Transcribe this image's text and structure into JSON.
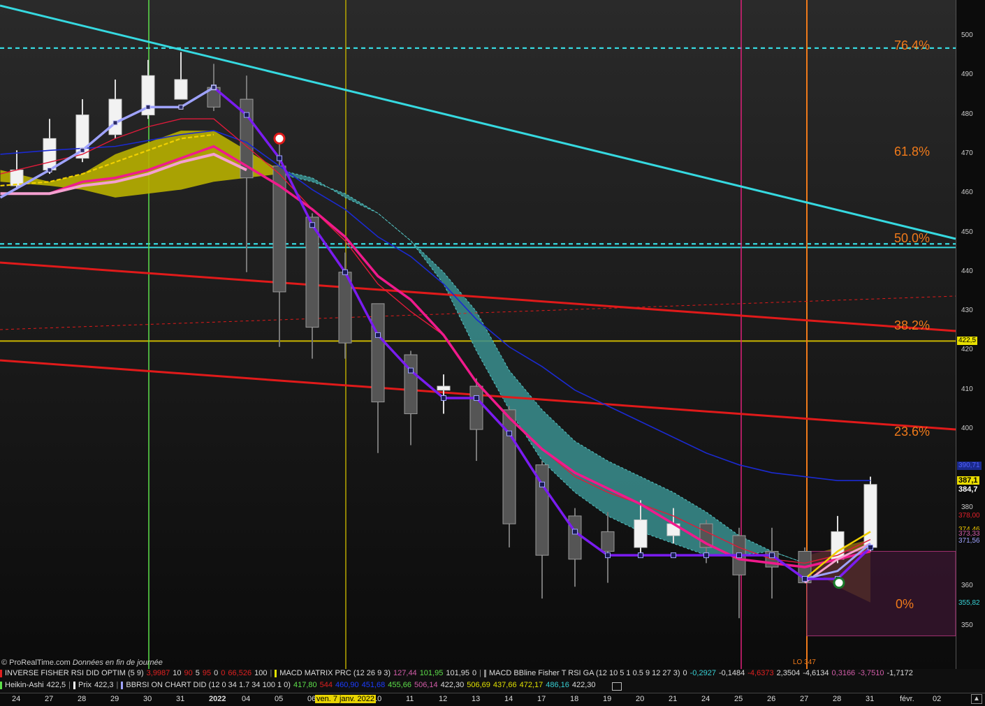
{
  "chart_data": {
    "type": "candlestick",
    "price_axis": {
      "ylim": [
        343,
        510
      ],
      "ticks": [
        500,
        490,
        480,
        470,
        460,
        450,
        440,
        430,
        420,
        410,
        400,
        380,
        360,
        350
      ],
      "tick_labels": [
        "500",
        "490",
        "480",
        "470",
        "460",
        "450",
        "440",
        "430",
        "420",
        "410",
        "400",
        "380",
        "360",
        "350"
      ]
    },
    "dates": [
      "24",
      "27",
      "28",
      "29",
      "30",
      "31",
      "2022",
      "04",
      "05",
      "06",
      "07",
      "10",
      "11",
      "12",
      "13",
      "14",
      "17",
      "18",
      "19",
      "20",
      "21",
      "24",
      "25",
      "26",
      "27",
      "28",
      "31",
      "févr.",
      "02"
    ],
    "candles": [
      {
        "o": 462,
        "h": 471,
        "l": 461,
        "c": 466,
        "bull": true
      },
      {
        "o": 466,
        "h": 479,
        "l": 465,
        "c": 474,
        "bull": true
      },
      {
        "o": 469,
        "h": 484,
        "l": 468,
        "c": 480,
        "bull": true
      },
      {
        "o": 475,
        "h": 489,
        "l": 474,
        "c": 484,
        "bull": true
      },
      {
        "o": 480,
        "h": 494,
        "l": 479,
        "c": 490,
        "bull": true
      },
      {
        "o": 484,
        "h": 496,
        "l": 484,
        "c": 489,
        "bull": true
      },
      {
        "o": 487,
        "h": 493,
        "l": 481,
        "c": 482,
        "bull": false
      },
      {
        "o": 484,
        "h": 490,
        "l": 440,
        "c": 464,
        "bull": false
      },
      {
        "o": 467,
        "h": 474,
        "l": 421,
        "c": 435,
        "bull": false
      },
      {
        "o": 454,
        "h": 455,
        "l": 418,
        "c": 426,
        "bull": false
      },
      {
        "o": 440,
        "h": 445,
        "l": 418,
        "c": 422,
        "bull": false
      },
      {
        "o": 432,
        "h": 432,
        "l": 394,
        "c": 407,
        "bull": false
      },
      {
        "o": 419,
        "h": 420,
        "l": 396,
        "c": 404,
        "bull": false
      },
      {
        "o": 410,
        "h": 414,
        "l": 404,
        "c": 411,
        "bull": true
      },
      {
        "o": 411,
        "h": 413,
        "l": 392,
        "c": 400,
        "bull": false
      },
      {
        "o": 405,
        "h": 406,
        "l": 370,
        "c": 376,
        "bull": false
      },
      {
        "o": 391,
        "h": 392,
        "l": 357,
        "c": 368,
        "bull": false
      },
      {
        "o": 378,
        "h": 380,
        "l": 360,
        "c": 367,
        "bull": false
      },
      {
        "o": 374,
        "h": 379,
        "l": 361,
        "c": 369,
        "bull": false
      },
      {
        "o": 370,
        "h": 382,
        "l": 368,
        "c": 377,
        "bull": true
      },
      {
        "o": 373,
        "h": 380,
        "l": 371,
        "c": 376,
        "bull": true
      },
      {
        "o": 376,
        "h": 377,
        "l": 366,
        "c": 370,
        "bull": false
      },
      {
        "o": 373,
        "h": 375,
        "l": 352,
        "c": 363,
        "bull": false
      },
      {
        "o": 369,
        "h": 375,
        "l": 357,
        "c": 365,
        "bull": false
      },
      {
        "o": 369,
        "h": 370,
        "l": 361,
        "c": 361,
        "bull": false
      },
      {
        "o": 367,
        "h": 378,
        "l": 366,
        "c": 374,
        "bull": true
      },
      {
        "o": 370,
        "h": 388,
        "l": 369,
        "c": 386,
        "bull": true
      }
    ],
    "fib_levels": [
      {
        "label": "76.4%",
        "price": 497.5
      },
      {
        "label": "61.8%",
        "price": 470.5
      },
      {
        "label": "50.0%",
        "price": 448.5
      },
      {
        "label": "38.2%",
        "price": 426.3
      },
      {
        "label": "23.6%",
        "price": 399.3
      },
      {
        "label": "0%",
        "price": 355.5
      }
    ],
    "horizontal_lines": [
      {
        "price": 497,
        "color": "#36d9e0",
        "style": "dashed"
      },
      {
        "price": 447.2,
        "color": "#36d9e0",
        "style": "dashed"
      },
      {
        "price": 446.3,
        "color": "#36d9e0",
        "style": "solid"
      },
      {
        "price": 422.5,
        "color": "#c8b400",
        "style": "solid"
      }
    ],
    "price_labels": [
      {
        "text": "422,5",
        "price": 422.5,
        "bg": "#e8e000",
        "fg": "#000"
      },
      {
        "text": "390,71",
        "price": 390.7,
        "bg": "#1b2a8c",
        "fg": "#1b2a8c"
      },
      {
        "text": "387,1",
        "price": 387.1,
        "bg": "#eadc00",
        "fg": "#000"
      },
      {
        "text": "384,7",
        "price": 384.7,
        "bg": "#0c0c0c",
        "fg": "#ffffff"
      },
      {
        "text": "378,00",
        "price": 378.0,
        "bg": "#0c0c0c",
        "fg": "#e0202a"
      },
      {
        "text": "374,46",
        "price": 374.5,
        "bg": "#0c0c0c",
        "fg": "#f0c800"
      },
      {
        "text": "373,33",
        "price": 373.3,
        "bg": "#0c0c0c",
        "fg": "#d25ca8"
      },
      {
        "text": "371,56",
        "price": 371.6,
        "bg": "#0c0c0c",
        "fg": "#9fa3ff"
      },
      {
        "text": "355,82",
        "price": 355.8,
        "bg": "#0c0c0c",
        "fg": "#37d0d4"
      }
    ],
    "colors": {
      "bull_candle": "#f2f2f2",
      "bear_candle": "#555555",
      "cyan_trend": "#36d9e0",
      "red_trend": "#e01a1a",
      "purple_line": "#7a1cf0",
      "pink_line": "#f01a8c",
      "lavender_line": "#9fa3ff",
      "yellow_cloud": "#b8b000",
      "teal_cloud": "#3a8f8f",
      "vline_green": "#5de04a",
      "vline_yellow": "#b8a800",
      "vline_magenta": "#e0207a",
      "vline_orange": "#f07a1a"
    }
  },
  "footer": {
    "credit_site": "© ProRealTime.com",
    "credit_note": "Données en fin de journée",
    "lo_label": "LO 347",
    "date_highlight": "ven. 7 janv. 2022",
    "indicators_row1": [
      {
        "parts": [
          {
            "t": "INVERSE FISHER RSI DID OPTIM (5 9)",
            "c": "#ddd"
          },
          {
            "t": "3,9987",
            "c": "#e02020"
          },
          {
            "t": "10",
            "c": "#ddd"
          },
          {
            "t": "90",
            "c": "#e02020"
          },
          {
            "t": "5",
            "c": "#ddd"
          },
          {
            "t": "95",
            "c": "#e02020"
          },
          {
            "t": "0",
            "c": "#ddd"
          },
          {
            "t": "0",
            "c": "#e02020"
          },
          {
            "t": "66,526",
            "c": "#e02020"
          },
          {
            "t": "100",
            "c": "#ddd"
          }
        ],
        "box": "#e02020"
      },
      {
        "parts": [
          {
            "t": "MACD MATRIX PRC (12 26 9 3)",
            "c": "#ddd"
          },
          {
            "t": "127,44",
            "c": "#d25ca8"
          },
          {
            "t": "101,95",
            "c": "#5de04a"
          },
          {
            "t": "101,95",
            "c": "#ddd"
          },
          {
            "t": "0",
            "c": "#ddd"
          }
        ],
        "box": "#e0e000"
      },
      {
        "parts": [
          {
            "t": "MACD  BBline  Fisher T RSI  GA (12 10 5 1 0.5 9 12 27 3)",
            "c": "#ddd"
          },
          {
            "t": "0",
            "c": "#ddd"
          },
          {
            "t": "-0,2927",
            "c": "#37d0d4"
          },
          {
            "t": "-0,1484",
            "c": "#ddd"
          },
          {
            "t": "-4,6373",
            "c": "#e02020"
          },
          {
            "t": "2,3504",
            "c": "#ddd"
          },
          {
            "t": "-4,6134",
            "c": "#ddd"
          },
          {
            "t": "0,3166",
            "c": "#d25ca8"
          },
          {
            "t": "-3,7510",
            "c": "#d25ca8"
          },
          {
            "t": "-1,7172",
            "c": "#ddd"
          }
        ],
        "box": "#888"
      }
    ],
    "indicators_row2": [
      {
        "parts": [
          {
            "t": "Heikin-Ashi",
            "c": "#ddd"
          },
          {
            "t": "422,5",
            "c": "#ddd"
          }
        ],
        "box": "#5de04a"
      },
      {
        "parts": [
          {
            "t": "Prix",
            "c": "#ddd"
          },
          {
            "t": "422,3",
            "c": "#ddd"
          }
        ],
        "box": "#ffffff"
      },
      {
        "parts": [
          {
            "t": "BBRSI ON CHART DID (12 0 34 1.7 34 100 1 0)",
            "c": "#ddd"
          },
          {
            "t": "417,80",
            "c": "#5de04a"
          },
          {
            "t": "544",
            "c": "#e02020"
          },
          {
            "t": "460,90",
            "c": "#1b3cff"
          },
          {
            "t": "451,68",
            "c": "#1b3cff"
          },
          {
            "t": "455,66",
            "c": "#5de04a"
          },
          {
            "t": "506,14",
            "c": "#d25ca8"
          },
          {
            "t": "422,30",
            "c": "#ddd"
          },
          {
            "t": "506,69",
            "c": "#e0e000"
          },
          {
            "t": "437,66",
            "c": "#e0e000"
          },
          {
            "t": "472,17",
            "c": "#e0e000"
          },
          {
            "t": "486,16",
            "c": "#37d0d4"
          },
          {
            "t": "422,30",
            "c": "#ddd"
          }
        ],
        "box": "#9fa3ff"
      }
    ]
  }
}
